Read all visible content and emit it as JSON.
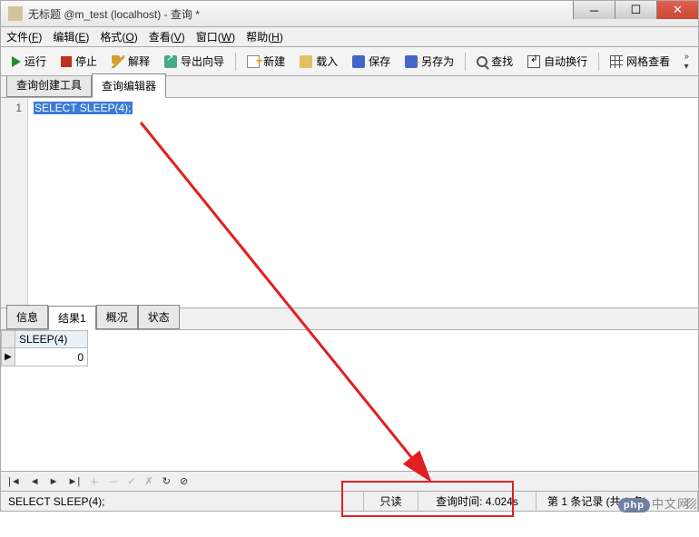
{
  "titlebar": {
    "text": "无标题 @m_test (localhost) - 查询 *"
  },
  "menubar": {
    "file": "文件",
    "edit": "编辑",
    "format": "格式",
    "view": "查看",
    "window": "窗口",
    "help": "帮助"
  },
  "menubar_keys": {
    "file": "F",
    "edit": "E",
    "format": "O",
    "view": "V",
    "window": "W",
    "help": "H"
  },
  "toolbar": {
    "run": "运行",
    "stop": "停止",
    "explain": "解释",
    "export": "导出向导",
    "new": "新建",
    "load": "载入",
    "save": "保存",
    "saveas": "另存为",
    "find": "查找",
    "wrap": "自动换行",
    "gridview": "网格查看"
  },
  "upper_tabs": {
    "builder": "查询创建工具",
    "editor": "查询编辑器"
  },
  "editor": {
    "line": "1",
    "code": "SELECT SLEEP(4);"
  },
  "result_tabs": {
    "info": "信息",
    "result1": "结果1",
    "profile": "概况",
    "status": "状态"
  },
  "grid": {
    "col1": "SLEEP(4)",
    "val1": "0"
  },
  "nav": {
    "first": "|◄",
    "prev": "◄",
    "next": "►",
    "last": "►|",
    "add": "＋",
    "del": "－",
    "ok": "✓",
    "cancel": "✗",
    "refresh": "↻",
    "stop2": "⊘"
  },
  "status": {
    "sql": "SELECT SLEEP(4);",
    "readonly": "只读",
    "querytime": "查询时间: 4.024s",
    "records": "第 1 条记录 (共 1 条)"
  },
  "watermark": "中文网"
}
